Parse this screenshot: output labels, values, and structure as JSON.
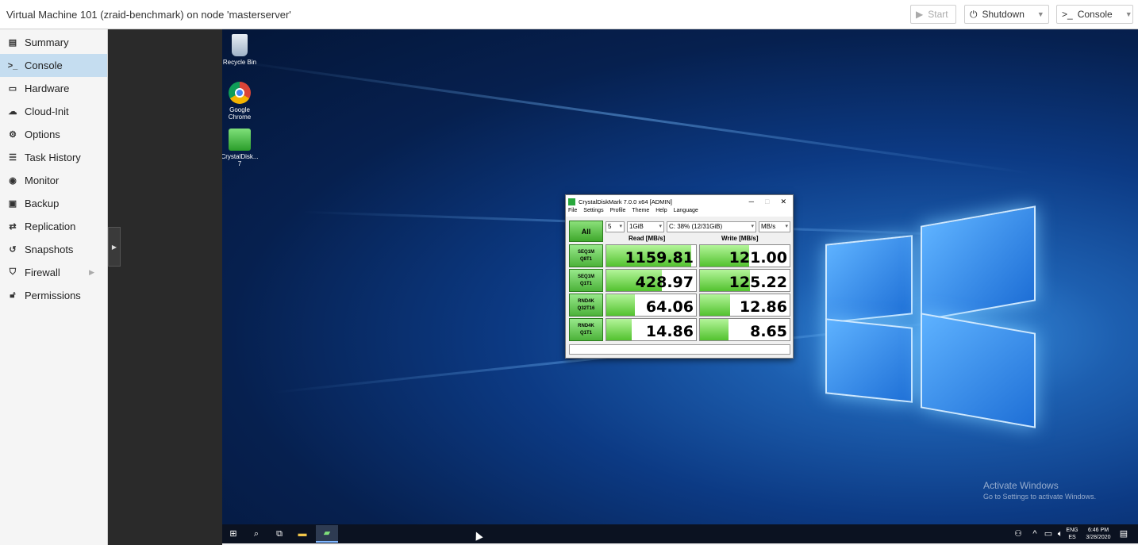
{
  "header": {
    "title": "Virtual Machine 101 (zraid-benchmark) on node 'masterserver'",
    "start_label": "Start",
    "shutdown_label": "Shutdown",
    "console_label": "Console"
  },
  "sidebar": {
    "items": [
      {
        "label": "Summary",
        "icon": "book-icon"
      },
      {
        "label": "Console",
        "icon": "terminal-icon"
      },
      {
        "label": "Hardware",
        "icon": "desktop-icon"
      },
      {
        "label": "Cloud-Init",
        "icon": "cloud-icon"
      },
      {
        "label": "Options",
        "icon": "gear-icon"
      },
      {
        "label": "Task History",
        "icon": "list-icon"
      },
      {
        "label": "Monitor",
        "icon": "eye-icon"
      },
      {
        "label": "Backup",
        "icon": "floppy-icon"
      },
      {
        "label": "Replication",
        "icon": "retweet-icon"
      },
      {
        "label": "Snapshots",
        "icon": "history-icon"
      },
      {
        "label": "Firewall",
        "icon": "shield-icon"
      },
      {
        "label": "Permissions",
        "icon": "unlock-icon"
      }
    ],
    "active": "Console"
  },
  "desktop": {
    "icons": [
      {
        "label": "Recycle Bin"
      },
      {
        "label": "Google Chrome"
      },
      {
        "label": "CrystalDisk... 7"
      }
    ],
    "activate_title": "Activate Windows",
    "activate_sub": "Go to Settings to activate Windows."
  },
  "cdm": {
    "title": "CrystalDiskMark 7.0.0 x64 [ADMIN]",
    "menu": [
      "File",
      "Settings",
      "Profile",
      "Theme",
      "Help",
      "Language"
    ],
    "all_label": "All",
    "count": "5",
    "size": "1GiB",
    "drive": "C: 38% (12/31GiB)",
    "unit": "MB/s",
    "read_header": "Read [MB/s]",
    "write_header": "Write [MB/s]",
    "rows": [
      {
        "l1": "SEQ1M",
        "l2": "Q8T1",
        "read": "1159.81",
        "write": "121.00",
        "read_fill": 0.95,
        "write_fill": 0.55
      },
      {
        "l1": "SEQ1M",
        "l2": "Q1T1",
        "read": "428.97",
        "write": "125.22",
        "read_fill": 0.62,
        "write_fill": 0.56
      },
      {
        "l1": "RND4K",
        "l2": "Q32T16",
        "read": "64.06",
        "write": "12.86",
        "read_fill": 0.32,
        "write_fill": 0.34
      },
      {
        "l1": "RND4K",
        "l2": "Q1T1",
        "read": "14.86",
        "write": "8.65",
        "read_fill": 0.28,
        "write_fill": 0.32
      }
    ]
  },
  "taskbar": {
    "lang": "ENG",
    "region": "ES",
    "time": "6:46 PM",
    "date": "3/28/2020"
  }
}
